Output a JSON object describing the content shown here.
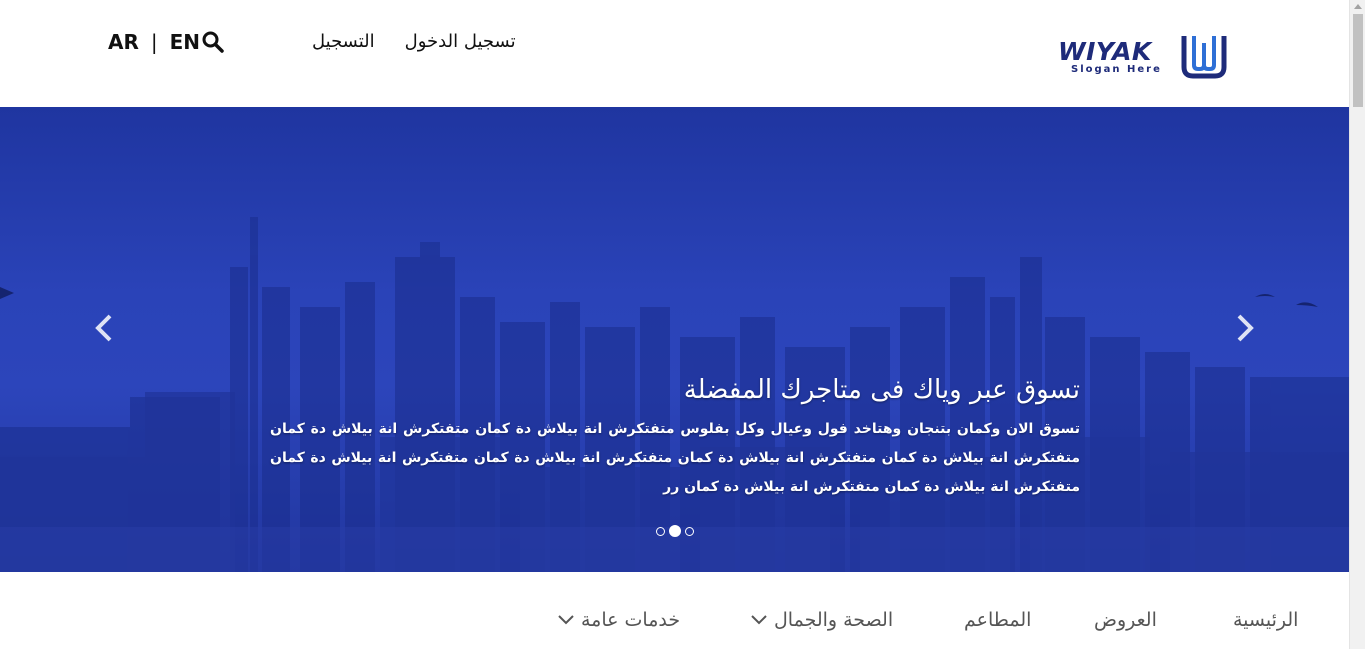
{
  "header": {
    "lang_ar": "AR",
    "lang_sep": "|",
    "lang_en": "EN",
    "search_icon": "search-icon",
    "login_label": "تسجيل الدخول",
    "register_label": "التسجيل",
    "logo_text": "WIYAK",
    "logo_slogan": "Slogan Here"
  },
  "hero": {
    "title": "تسوق عبر وياك فى متاجرك المفضلة",
    "text": "تسوق الان وكمان بتنجان وهتاخد فول وعيال وكل بفلوس متفتكرش انة بيلاش دة كمان متفتكرش انة بيلاش دة كمان متفتكرش انة بيلاش دة كمان متفتكرش انة بيلاش دة كمان متفتكرش انة بيلاش دة كمان متفتكرش انة بيلاش دة كمان متفتكرش انة بيلاش دة كمان متفتكرش انة بيلاش دة كمان رر",
    "prev_icon": "chevron-left-icon",
    "next_icon": "chevron-right-icon",
    "slides_count": 3,
    "active_slide": 2
  },
  "nav": {
    "items": [
      {
        "label": "الرئيسية"
      },
      {
        "label": "العروض"
      },
      {
        "label": "المطاعم"
      },
      {
        "label": "الصحة والجمال",
        "dropdown": true
      },
      {
        "label": "خدمات عامة",
        "dropdown": true
      }
    ]
  },
  "colors": {
    "brand": "#1e2b7a",
    "hero_blue": "#2439a3",
    "nav_text": "#555555"
  }
}
